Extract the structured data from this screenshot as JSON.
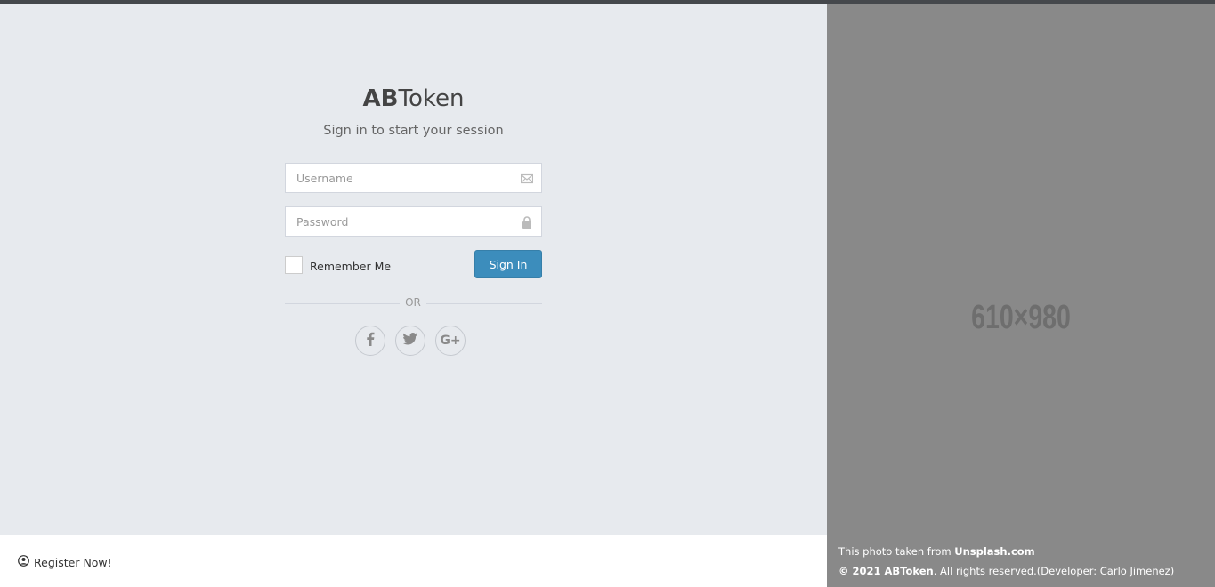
{
  "brand": {
    "bold": "AB",
    "regular": "Token"
  },
  "subtitle": "Sign in to start your session",
  "username": {
    "placeholder": "Username",
    "value": ""
  },
  "password": {
    "placeholder": "Password",
    "value": ""
  },
  "remember_label": "Remember Me",
  "signin_label": "Sign In",
  "or_label": "OR",
  "social": {
    "facebook": "f",
    "twitter": "t",
    "google": "G+"
  },
  "footer": {
    "register_label": "Register Now!"
  },
  "right_panel": {
    "placeholder_label": "610×980",
    "credit_prefix": "This photo taken from ",
    "credit_source": "Unsplash.com",
    "copyright_prefix": "© 2021 ",
    "copyright_brand": "ABToken",
    "copyright_suffix": ". All rights reserved.(Developer: Carlo Jimenez)"
  },
  "colors": {
    "accent": "#3c8dbc",
    "left_bg": "#e7eaee",
    "right_bg": "#898989"
  }
}
